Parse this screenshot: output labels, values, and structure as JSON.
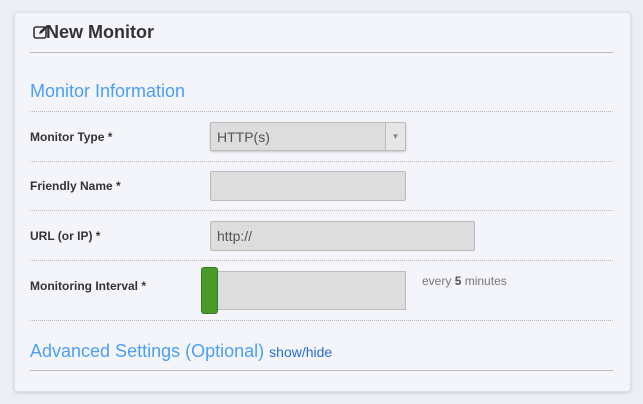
{
  "header": {
    "title": "New Monitor",
    "icon": "edit-icon"
  },
  "section": {
    "title": "Monitor Information"
  },
  "fields": {
    "monitor_type": {
      "label": "Monitor Type *",
      "value": "HTTP(s)"
    },
    "friendly_name": {
      "label": "Friendly Name *",
      "value": ""
    },
    "url": {
      "label": "URL (or IP) *",
      "value": "http://"
    },
    "interval": {
      "label": "Monitoring Interval *",
      "prefix": "every",
      "value": "5",
      "suffix": "minutes",
      "slider_fraction": 0
    }
  },
  "advanced": {
    "title": "Advanced Settings (Optional)",
    "toggle": "show/hide"
  },
  "colors": {
    "accent": "#4a9ff5",
    "slider": "#4a9a2a"
  }
}
